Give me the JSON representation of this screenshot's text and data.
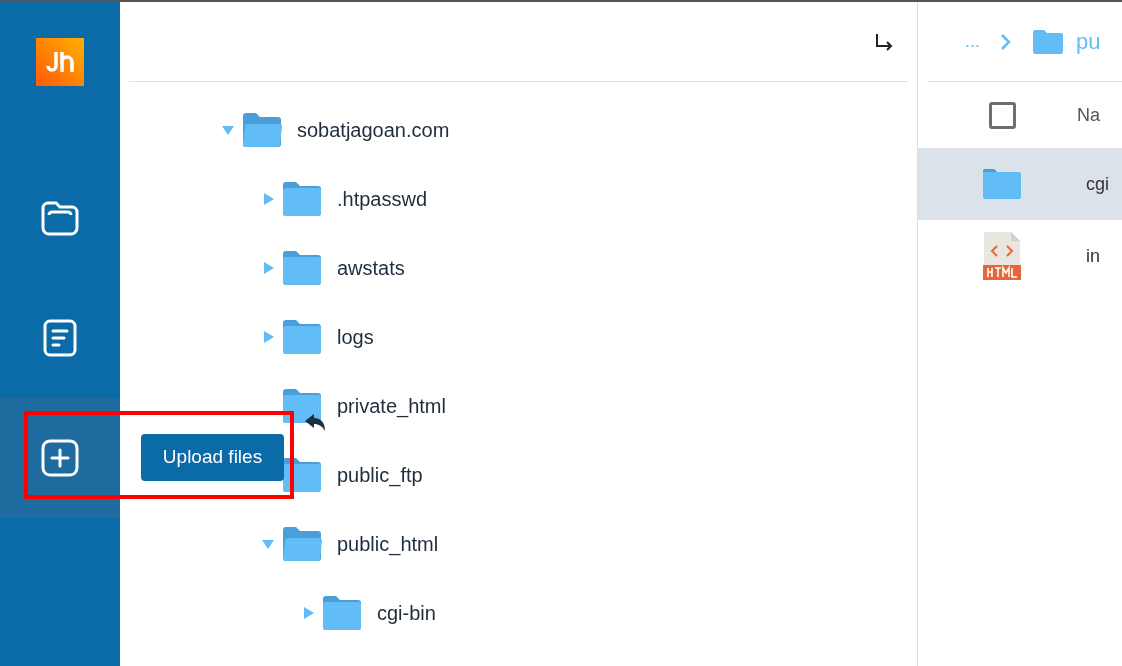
{
  "sidebar": {
    "items": [
      {
        "kind": "folder",
        "selected": false
      },
      {
        "kind": "document",
        "selected": false
      },
      {
        "kind": "plus",
        "selected": true
      }
    ]
  },
  "tooltip": {
    "text": "Upload files"
  },
  "tree": {
    "items": [
      {
        "name": "sobatjagoan.com",
        "expanded": true,
        "children": [
          {
            "name": ".htpasswd",
            "expanded": false
          },
          {
            "name": "awstats",
            "expanded": false
          },
          {
            "name": "logs",
            "expanded": false
          },
          {
            "name": "private_html",
            "symlink": true
          },
          {
            "name": "public_ftp"
          },
          {
            "name": "public_html",
            "expanded": true,
            "children": [
              {
                "name": "cgi-bin",
                "expanded": false
              }
            ]
          }
        ]
      }
    ]
  },
  "breadcrumb": {
    "ellipsis": "...",
    "current": "pu"
  },
  "table": {
    "header": {
      "name": "Na",
      "checked": false
    },
    "rows": [
      {
        "kind": "folder",
        "name": "cgi",
        "selected": true
      },
      {
        "kind": "html",
        "name": "in",
        "selected": false
      }
    ]
  }
}
